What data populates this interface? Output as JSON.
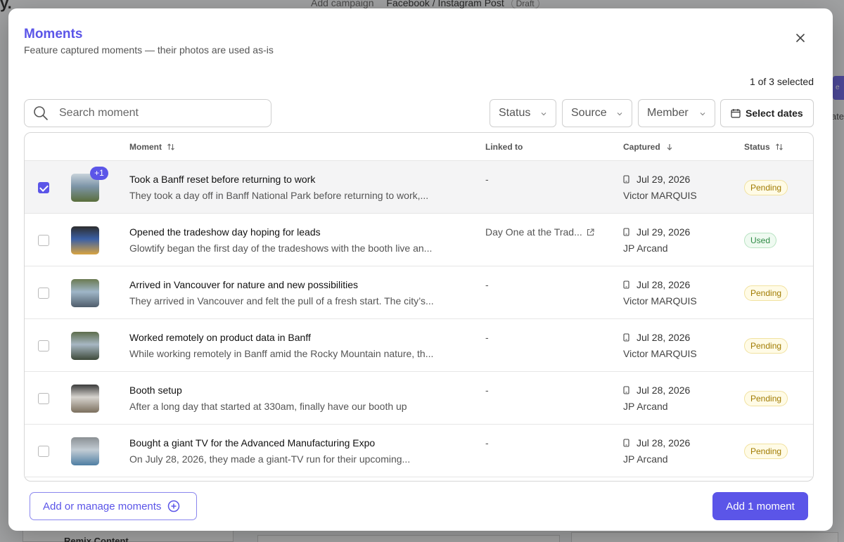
{
  "background": {
    "logo": "y.",
    "breadcrumb_add": "Add campaign",
    "breadcrumb_post": "Facebook / Instagram Post",
    "draft_badge": "Draft",
    "right_label": "ate",
    "bottom_label": "Remix Content"
  },
  "modal": {
    "title": "Moments",
    "subtitle": "Feature captured moments — their photos are used as-is",
    "selected_count": "1 of 3 selected",
    "search_placeholder": "Search moment",
    "filters": {
      "status": "Status",
      "source": "Source",
      "member": "Member",
      "dates": "Select dates"
    },
    "columns": {
      "moment": "Moment",
      "linked_to": "Linked to",
      "captured": "Captured",
      "status": "Status"
    },
    "rows": [
      {
        "checked": true,
        "extra_photos": "+1",
        "title": "Took a Banff reset before returning to work",
        "desc": "They took a day off in Banff National Park before returning to work,...",
        "linked": "-",
        "date": "Jul 29, 2026",
        "member": "Victor MARQUIS",
        "status": "Pending",
        "status_kind": "pending",
        "thumb_colors": [
          "#7d95a8",
          "#5a6e3c",
          "#c8d3db"
        ]
      },
      {
        "checked": false,
        "title": "Opened the tradeshow day hoping for leads",
        "desc": "Glowtify began the first day of the tradeshows with the booth live an...",
        "linked": "Day One at the Trad...",
        "date": "Jul 29, 2026",
        "member": "JP Arcand",
        "status": "Used",
        "status_kind": "used",
        "thumb_colors": [
          "#3a5fa5",
          "#d9a441",
          "#2d2d2d"
        ]
      },
      {
        "checked": false,
        "title": "Arrived in Vancouver for nature and new possibilities",
        "desc": "They arrived in Vancouver and felt the pull of a fresh start. The city’s...",
        "linked": "-",
        "date": "Jul 28, 2026",
        "member": "Victor MARQUIS",
        "status": "Pending",
        "status_kind": "pending",
        "thumb_colors": [
          "#9fb6c8",
          "#4f5d6b",
          "#6b7a52"
        ]
      },
      {
        "checked": false,
        "title": "Worked remotely on product data in Banff",
        "desc": "While working remotely in Banff amid the Rocky Mountain nature, th...",
        "linked": "-",
        "date": "Jul 28, 2026",
        "member": "Victor MARQUIS",
        "status": "Pending",
        "status_kind": "pending",
        "thumb_colors": [
          "#a7b7c3",
          "#3e4a3a",
          "#5d6d4c"
        ]
      },
      {
        "checked": false,
        "title": "Booth setup",
        "desc": "After a long day that started at 330am, finally have our booth up",
        "linked": "-",
        "date": "Jul 28, 2026",
        "member": "JP Arcand",
        "status": "Pending",
        "status_kind": "pending",
        "thumb_colors": [
          "#d7d4cf",
          "#7b6f5d",
          "#3a3a3a"
        ]
      },
      {
        "checked": false,
        "title": "Bought a giant TV for the Advanced Manufacturing Expo",
        "desc": "On July 28, 2026, they made a giant-TV run for their upcoming...",
        "linked": "-",
        "date": "Jul 28, 2026",
        "member": "JP Arcand",
        "status": "Pending",
        "status_kind": "pending",
        "thumb_colors": [
          "#c2ccd4",
          "#4f7ea3",
          "#8a8f93"
        ]
      }
    ],
    "manage_button": "Add or manage moments",
    "add_button": "Add 1 moment"
  },
  "colors": {
    "accent": "#5b55e8",
    "pending_text": "#a07b00",
    "used_text": "#2e8a45"
  },
  "icons": [
    "search-icon",
    "chevron-down-icon",
    "calendar-icon",
    "close-icon",
    "sort-icon",
    "arrow-down-icon",
    "phone-icon",
    "external-link-icon",
    "plus-circle-icon"
  ]
}
